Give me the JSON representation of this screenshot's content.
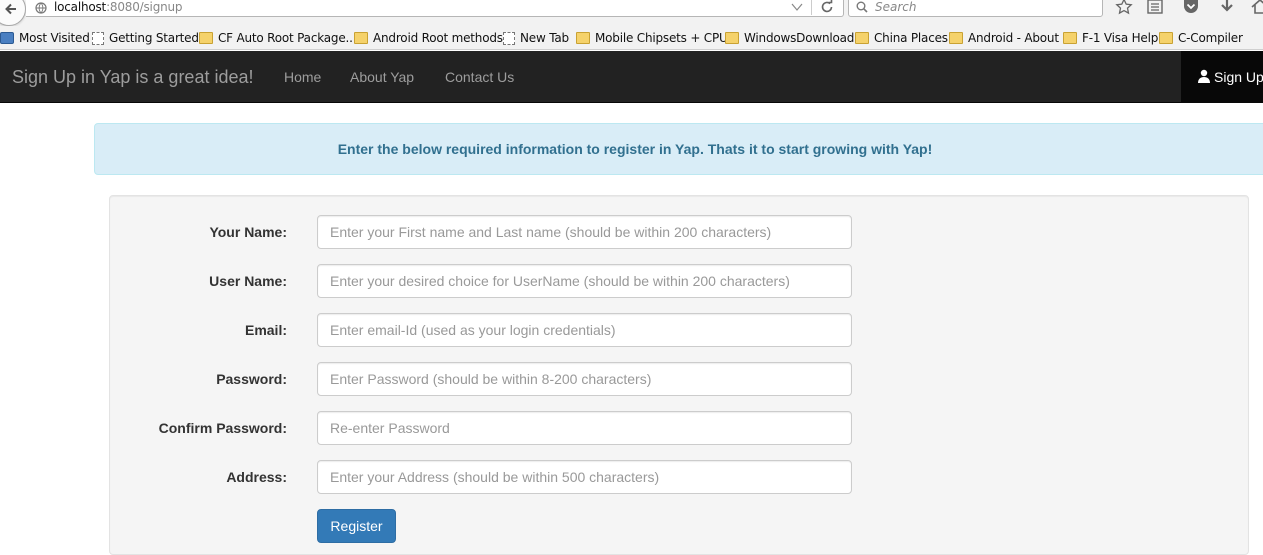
{
  "browser": {
    "url_host": "localhost",
    "url_path": ":8080/signup",
    "search_placeholder": "Search",
    "bookmarks": [
      {
        "label": "Most Visited",
        "icon": "most-visited-icon"
      },
      {
        "label": "Getting Started",
        "icon": "page-icon"
      },
      {
        "label": "CF Auto Root Package...",
        "icon": "folder-icon"
      },
      {
        "label": "Android Root methods",
        "icon": "folder-icon"
      },
      {
        "label": "New Tab",
        "icon": "page-icon"
      },
      {
        "label": "Mobile Chipsets + CPU",
        "icon": "folder-icon"
      },
      {
        "label": "WindowsDownload",
        "icon": "folder-icon"
      },
      {
        "label": "China Places",
        "icon": "folder-icon"
      },
      {
        "label": "Android - About",
        "icon": "folder-icon"
      },
      {
        "label": "F-1 Visa Help",
        "icon": "folder-icon"
      },
      {
        "label": "C-Compiler",
        "icon": "folder-icon"
      }
    ]
  },
  "navbar": {
    "brand": "Sign Up in Yap is a great idea!",
    "links": [
      "Home",
      "About Yap",
      "Contact Us"
    ],
    "signup": "Sign Up"
  },
  "alert": {
    "text": "Enter the below required information to register in Yap. Thats it to start growing with Yap!"
  },
  "form": {
    "fields": [
      {
        "label": "Your Name:",
        "placeholder": "Enter your First name and Last name (should be within 200 characters)"
      },
      {
        "label": "User Name:",
        "placeholder": "Enter your desired choice for UserName (should be within 200 characters)"
      },
      {
        "label": "Email:",
        "placeholder": "Enter email-Id (used as your login credentials)"
      },
      {
        "label": "Password:",
        "placeholder": "Enter Password (should be within 8-200 characters)"
      },
      {
        "label": "Confirm Password:",
        "placeholder": "Re-enter Password"
      },
      {
        "label": "Address:",
        "placeholder": "Enter your Address (should be within 500 characters)"
      }
    ],
    "submit": "Register"
  },
  "colors": {
    "navbar_bg": "#222222",
    "alert_bg": "#d9edf7",
    "alert_text": "#31708f",
    "primary": "#337ab7"
  }
}
